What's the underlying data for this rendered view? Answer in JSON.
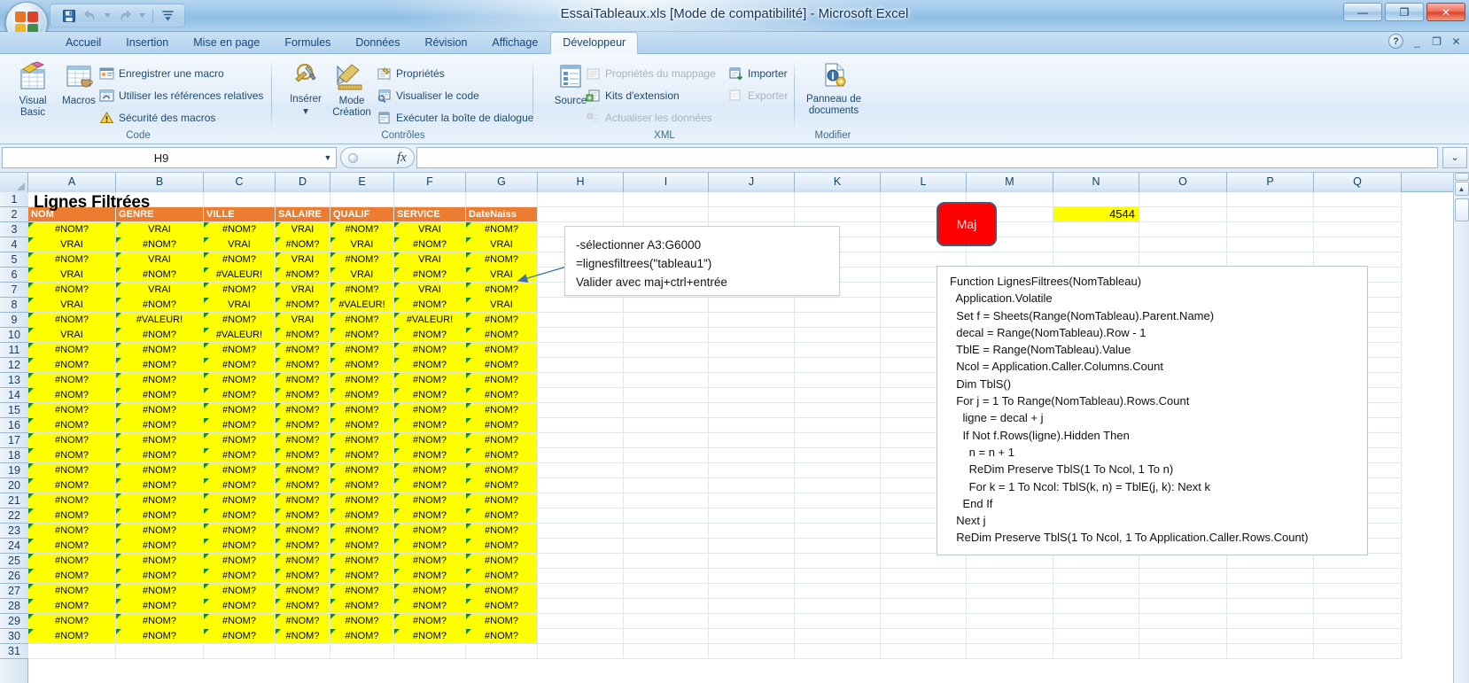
{
  "window": {
    "title": "EssaiTableaux.xls  [Mode de compatibilité] - Microsoft Excel",
    "minimize": "—",
    "maximize": "❐",
    "close": "✕"
  },
  "quick_access": {
    "save": "save-icon",
    "undo": "undo-icon",
    "redo": "redo-icon",
    "customize": "customize-icon"
  },
  "tabs": [
    {
      "label": "Accueil",
      "active": false
    },
    {
      "label": "Insertion",
      "active": false
    },
    {
      "label": "Mise en page",
      "active": false
    },
    {
      "label": "Formules",
      "active": false
    },
    {
      "label": "Données",
      "active": false
    },
    {
      "label": "Révision",
      "active": false
    },
    {
      "label": "Affichage",
      "active": false
    },
    {
      "label": "Développeur",
      "active": true
    }
  ],
  "tab_right": {
    "help": "?",
    "minimize_ribbon": "_",
    "restore": "❐",
    "close": "✕"
  },
  "ribbon": {
    "groups": [
      {
        "name": "Code",
        "label": "Code",
        "big_buttons": [
          {
            "label": "Visual Basic",
            "icon": "visual-basic-icon"
          },
          {
            "label": "Macros",
            "icon": "macros-icon"
          }
        ],
        "small_buttons": [
          {
            "label": "Enregistrer une macro",
            "icon": "record-macro-icon",
            "disabled": false
          },
          {
            "label": "Utiliser les références relatives",
            "icon": "relative-references-icon",
            "disabled": false
          },
          {
            "label": "Sécurité des macros",
            "icon": "macro-security-icon",
            "disabled": false
          }
        ]
      },
      {
        "name": "Controles",
        "label": "Contrôles",
        "big_buttons": [
          {
            "label": "Insérer",
            "icon": "insert-control-icon",
            "dropdown": "▾"
          },
          {
            "label": "Mode Création",
            "icon": "design-mode-icon"
          }
        ],
        "small_buttons": [
          {
            "label": "Propriétés",
            "icon": "properties-icon",
            "disabled": false
          },
          {
            "label": "Visualiser le code",
            "icon": "view-code-icon",
            "disabled": false
          },
          {
            "label": "Exécuter la boîte de dialogue",
            "icon": "run-dialog-icon",
            "disabled": false
          }
        ]
      },
      {
        "name": "XML",
        "label": "XML",
        "big_buttons": [
          {
            "label": "Source",
            "icon": "xml-source-icon"
          }
        ],
        "small_buttons": [
          {
            "label": "Propriétés du mappage",
            "icon": "map-properties-icon",
            "disabled": true
          },
          {
            "label": "Kits d'extension",
            "icon": "expansion-packs-icon",
            "disabled": false
          },
          {
            "label": "Actualiser les données",
            "icon": "refresh-data-icon",
            "disabled": true
          },
          {
            "label": "Importer",
            "icon": "import-icon",
            "disabled": false
          },
          {
            "label": "Exporter",
            "icon": "export-icon",
            "disabled": true
          }
        ]
      },
      {
        "name": "Modifier",
        "label": "Modifier",
        "big_buttons": [
          {
            "label": "Panneau de documents",
            "icon": "document-panel-icon"
          }
        ],
        "small_buttons": []
      }
    ]
  },
  "formula_bar": {
    "name_box_value": "H9",
    "name_box_dropdown": "▼",
    "cancel_icon": "cancel-icon",
    "confirm_icon": "confirm-icon",
    "fx_icon": "fx",
    "formula_value": "",
    "expand_icon": "⌄"
  },
  "grid": {
    "column_headers": [
      "A",
      "B",
      "C",
      "D",
      "E",
      "F",
      "G",
      "H",
      "I",
      "J",
      "K",
      "L",
      "M",
      "N",
      "O",
      "P",
      "Q"
    ],
    "row_headers": [
      "1",
      "2",
      "3",
      "4",
      "5",
      "6",
      "7",
      "8",
      "9",
      "10",
      "11",
      "12",
      "13",
      "14",
      "15",
      "16",
      "17",
      "18",
      "19",
      "20",
      "21",
      "22",
      "23",
      "24",
      "25",
      "26",
      "27",
      "28",
      "29",
      "30",
      "31"
    ],
    "sheet_title": "Lignes Filtrées",
    "table_headers": [
      "NOM",
      "GENRE",
      "VILLE",
      "SALAIRE",
      "QUALIF",
      "SERVICE",
      "DateNaiss"
    ],
    "data_rows": [
      [
        "#NOM?",
        "VRAI",
        "#NOM?",
        "VRAI",
        "#NOM?",
        "VRAI",
        "#NOM?"
      ],
      [
        "VRAI",
        "#NOM?",
        "VRAI",
        "#NOM?",
        "VRAI",
        "#NOM?",
        "VRAI"
      ],
      [
        "#NOM?",
        "VRAI",
        "#NOM?",
        "VRAI",
        "#NOM?",
        "VRAI",
        "#NOM?"
      ],
      [
        "VRAI",
        "#NOM?",
        "#VALEUR!",
        "#NOM?",
        "VRAI",
        "#NOM?",
        "VRAI"
      ],
      [
        "#NOM?",
        "VRAI",
        "#NOM?",
        "VRAI",
        "#NOM?",
        "VRAI",
        "#NOM?"
      ],
      [
        "VRAI",
        "#NOM?",
        "VRAI",
        "#NOM?",
        "#VALEUR!",
        "#NOM?",
        "VRAI"
      ],
      [
        "#NOM?",
        "#VALEUR!",
        "#NOM?",
        "VRAI",
        "#NOM?",
        "#VALEUR!",
        "#NOM?"
      ],
      [
        "VRAI",
        "#NOM?",
        "#VALEUR!",
        "#NOM?",
        "#NOM?",
        "#NOM?",
        "#NOM?"
      ],
      [
        "#NOM?",
        "#NOM?",
        "#NOM?",
        "#NOM?",
        "#NOM?",
        "#NOM?",
        "#NOM?"
      ],
      [
        "#NOM?",
        "#NOM?",
        "#NOM?",
        "#NOM?",
        "#NOM?",
        "#NOM?",
        "#NOM?"
      ],
      [
        "#NOM?",
        "#NOM?",
        "#NOM?",
        "#NOM?",
        "#NOM?",
        "#NOM?",
        "#NOM?"
      ],
      [
        "#NOM?",
        "#NOM?",
        "#NOM?",
        "#NOM?",
        "#NOM?",
        "#NOM?",
        "#NOM?"
      ],
      [
        "#NOM?",
        "#NOM?",
        "#NOM?",
        "#NOM?",
        "#NOM?",
        "#NOM?",
        "#NOM?"
      ],
      [
        "#NOM?",
        "#NOM?",
        "#NOM?",
        "#NOM?",
        "#NOM?",
        "#NOM?",
        "#NOM?"
      ],
      [
        "#NOM?",
        "#NOM?",
        "#NOM?",
        "#NOM?",
        "#NOM?",
        "#NOM?",
        "#NOM?"
      ],
      [
        "#NOM?",
        "#NOM?",
        "#NOM?",
        "#NOM?",
        "#NOM?",
        "#NOM?",
        "#NOM?"
      ],
      [
        "#NOM?",
        "#NOM?",
        "#NOM?",
        "#NOM?",
        "#NOM?",
        "#NOM?",
        "#NOM?"
      ],
      [
        "#NOM?",
        "#NOM?",
        "#NOM?",
        "#NOM?",
        "#NOM?",
        "#NOM?",
        "#NOM?"
      ],
      [
        "#NOM?",
        "#NOM?",
        "#NOM?",
        "#NOM?",
        "#NOM?",
        "#NOM?",
        "#NOM?"
      ],
      [
        "#NOM?",
        "#NOM?",
        "#NOM?",
        "#NOM?",
        "#NOM?",
        "#NOM?",
        "#NOM?"
      ],
      [
        "#NOM?",
        "#NOM?",
        "#NOM?",
        "#NOM?",
        "#NOM?",
        "#NOM?",
        "#NOM?"
      ],
      [
        "#NOM?",
        "#NOM?",
        "#NOM?",
        "#NOM?",
        "#NOM?",
        "#NOM?",
        "#NOM?"
      ],
      [
        "#NOM?",
        "#NOM?",
        "#NOM?",
        "#NOM?",
        "#NOM?",
        "#NOM?",
        "#NOM?"
      ],
      [
        "#NOM?",
        "#NOM?",
        "#NOM?",
        "#NOM?",
        "#NOM?",
        "#NOM?",
        "#NOM?"
      ],
      [
        "#NOM?",
        "#NOM?",
        "#NOM?",
        "#NOM?",
        "#NOM?",
        "#NOM?",
        "#NOM?"
      ],
      [
        "#NOM?",
        "#NOM?",
        "#NOM?",
        "#NOM?",
        "#NOM?",
        "#NOM?",
        "#NOM?"
      ],
      [
        "#NOM?",
        "#NOM?",
        "#NOM?",
        "#NOM?",
        "#NOM?",
        "#NOM?",
        "#NOM?"
      ],
      [
        "#NOM?",
        "#NOM?",
        "#NOM?",
        "#NOM?",
        "#NOM?",
        "#NOM?",
        "#NOM?"
      ]
    ],
    "result_cell": {
      "ref": "N2",
      "value": "4544",
      "background": "#ffff00"
    }
  },
  "shapes": {
    "maj_button": {
      "label": "Maj",
      "fill": "#fe0000",
      "border": "#3f5c78",
      "text_color": "#f2f2f2"
    },
    "callout": {
      "lines": [
        "-sélectionner A3:G6000",
        "=lignesfiltrees(\"tableau1\")",
        "Valider avec maj+ctrl+entrée"
      ]
    },
    "code_box": {
      "lines": [
        "Function LignesFiltrees(NomTableau)",
        "  Application.Volatile",
        "  Set f = Sheets(Range(NomTableau).Parent.Name)",
        "  decal = Range(NomTableau).Row - 1",
        "  TblE = Range(NomTableau).Value",
        "  Ncol = Application.Caller.Columns.Count",
        "  Dim TblS()",
        "  For j = 1 To Range(NomTableau).Rows.Count",
        "    ligne = decal + j",
        "    If Not f.Rows(ligne).Hidden Then",
        "      n = n + 1",
        "      ReDim Preserve TblS(1 To Ncol, 1 To n)",
        "      For k = 1 To Ncol: TblS(k, n) = TblE(j, k): Next k",
        "    End If",
        "  Next j",
        "  ReDim Preserve TblS(1 To Ncol, 1 To Application.Caller.Rows.Count)"
      ]
    }
  },
  "scrollbar": {
    "up_arrow": "▲",
    "split": "split-handle",
    "down_arrow": "▼"
  },
  "colors": {
    "table_header_orange": "#ec7c30",
    "cell_yellow": "#ffff00",
    "maj_red": "#fe0000",
    "ribbon_blue": "#dbeaf7"
  }
}
